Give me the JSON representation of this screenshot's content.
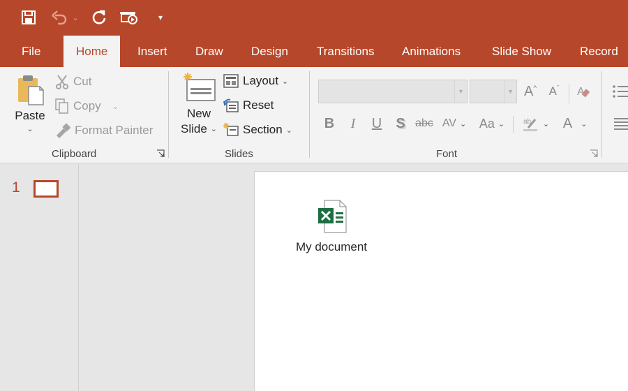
{
  "quick_access": {
    "save_icon": "save-icon",
    "undo_icon": "undo-icon",
    "redo_icon": "repeat-icon",
    "present_icon": "start-from-beginning-icon",
    "customize_icon": "customize-qat-icon"
  },
  "tabs": [
    {
      "label": "File"
    },
    {
      "label": "Home"
    },
    {
      "label": "Insert"
    },
    {
      "label": "Draw"
    },
    {
      "label": "Design"
    },
    {
      "label": "Transitions"
    },
    {
      "label": "Animations"
    },
    {
      "label": "Slide Show"
    },
    {
      "label": "Record"
    }
  ],
  "active_tab": "Home",
  "ribbon": {
    "clipboard": {
      "label": "Clipboard",
      "paste": "Paste",
      "cut": "Cut",
      "copy": "Copy",
      "format_painter": "Format Painter"
    },
    "slides": {
      "label": "Slides",
      "new_slide_line1": "New",
      "new_slide_line2": "Slide",
      "layout": "Layout",
      "reset": "Reset",
      "section": "Section"
    },
    "font": {
      "label": "Font",
      "font_name_value": "",
      "font_size_value": "",
      "bold": "B",
      "italic": "I",
      "underline": "U",
      "shadow": "S",
      "strikethrough": "abc",
      "spacing": "AV",
      "change_case": "Aa",
      "font_color": "A"
    }
  },
  "thumbnails": {
    "slide_number": "1"
  },
  "slide": {
    "embedded_file_caption": "My document",
    "embedded_file_icon": "excel-file-icon"
  },
  "colors": {
    "accent": "#b7472a",
    "ribbon_bg": "#f3f3f3",
    "workspace_bg": "#e6e6e6",
    "excel_green": "#1d6f42"
  }
}
